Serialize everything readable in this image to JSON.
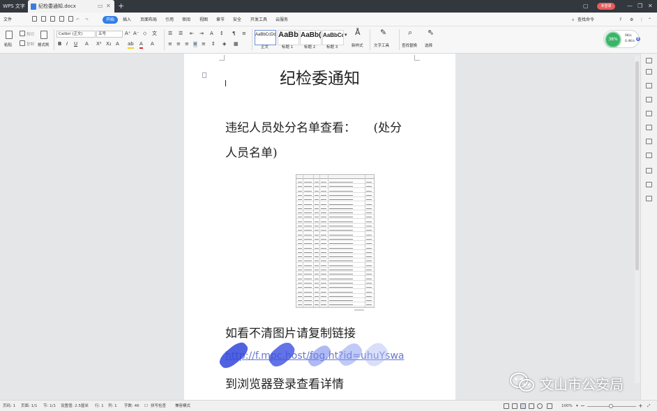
{
  "titlebar": {
    "app": "WPS 文字",
    "tab_name": "纪检委通知.docx",
    "new_tab": "+",
    "login": "未登录"
  },
  "menu": {
    "file": "文件",
    "items": [
      "开始",
      "插入",
      "页面布局",
      "引用",
      "审阅",
      "视图",
      "章节",
      "安全",
      "开发工具",
      "云服务"
    ],
    "search": "查找命令"
  },
  "toolbar": {
    "paste": "粘贴",
    "cut": "剪切",
    "copy": "复制",
    "format_painter": "格式刷",
    "font": "Calibri (正文)",
    "size": "五号",
    "styles": [
      {
        "preview": "AaBbCcDd",
        "name": "正文"
      },
      {
        "preview": "AaBb",
        "name": "标题 1"
      },
      {
        "preview": "AaBb(",
        "name": "标题 2"
      },
      {
        "preview": "AaBbCc",
        "name": "标题 3"
      }
    ],
    "new_style": "新样式",
    "text_tools": "文字工具",
    "find_replace": "查找替换",
    "select": "选择"
  },
  "speed": {
    "percent": "38%",
    "up": "0K/s",
    "down": "0.4K/s",
    "badge": "8"
  },
  "document": {
    "title": "纪检委通知",
    "line1": "违纪人员处分名单查看：　　(处分",
    "line2": "人员名单)",
    "line3": "如看不清图片请复制链接",
    "link": "http://f.mpc.host/fog.ht?id=uhuYswa",
    "line4": "到浏览器登录查看详情"
  },
  "statusbar": {
    "page_no": "页码: 1",
    "pages": "页面: 1/1",
    "section": "节: 1/1",
    "setting": "设置值: 2.5厘米",
    "row": "行: 1",
    "col": "列: 1",
    "words": "字数: 46",
    "spell": "拼写检查",
    "mode": "兼容模式",
    "zoom": "100%"
  },
  "watermark": {
    "text": "文山市公安局"
  }
}
